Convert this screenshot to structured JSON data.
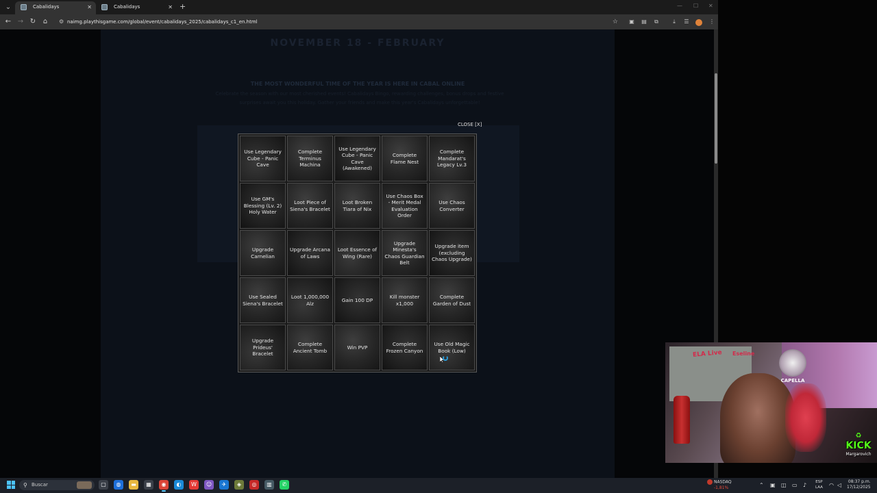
{
  "tabs": [
    {
      "title": "Cabalidays",
      "active": true
    },
    {
      "title": "Cabalidays",
      "active": false
    }
  ],
  "address": {
    "url": "naimg.playthisgame.com/global/event/cabalidays_2025/cabalidays_c1_en.html"
  },
  "page": {
    "title": "NOVEMBER 18 - FEBRUARY",
    "heading": "THE MOST WONDERFUL TIME OF THE YEAR IS HERE IN CABAL ONLINE",
    "description": "Celebrate the season with our most cherished events! Cabalidays Bingo, rewarding challenges, bonus drops and festive surprises await you this holiday. Gather your friends and make this year's Cabalidays unforgettable!"
  },
  "modal": {
    "close_label": "CLOSE [X]",
    "cells": [
      "Use Legendary Cube - Panic Cave",
      "Complete Terminus Machina",
      "Use Legendary Cube - Panic Cave (Awakened)",
      "Complete Flame Nest",
      "Complete Mandarat's Legacy Lv.3",
      "Use GM's Blessing (Lv. 2) Holy Water",
      "Loot Piece of Siena's Bracelet",
      "Loot Broken Tiara of Nix",
      "Use Chaos Box - Merit Medal Evaluation Order",
      "Use Chaos Converter",
      "Upgrade Carnelian",
      "Upgrade Arcana of Laws",
      "Loot Essence of Wing (Rare)",
      "Upgrade Minesta's Chaos Guardian Belt",
      "Upgrade item (excluding Chaos Upgrade)",
      "Use Sealed Siena's Bracelet",
      "Loot 1,000,000 Alz",
      "Gain 100 DP",
      "Kill monster x1,000",
      "Complete Garden of Dust",
      "Upgrade Prideus' Bracelet",
      "Complete Ancient Tomb",
      "Win PVP",
      "Complete Frozen Canyon",
      "Use Old Magic Book (Low)"
    ]
  },
  "stream": {
    "overlay_brand": "CAPELLA",
    "platform": "KICK",
    "username": "Margarovich",
    "sign_a": "ELA Live",
    "sign_b": "Eseline"
  },
  "taskbar": {
    "search_placeholder": "Buscar",
    "stock_name": "NASDAQ",
    "stock_change": "-1,81%",
    "lang_top": "ESP",
    "lang_bottom": "LAA",
    "time": "08:37 p.m.",
    "date": "17/12/2025"
  },
  "colors": {
    "accent": "#60cdff",
    "kick_green": "#53fc18",
    "stock_red": "#e74c3c"
  }
}
